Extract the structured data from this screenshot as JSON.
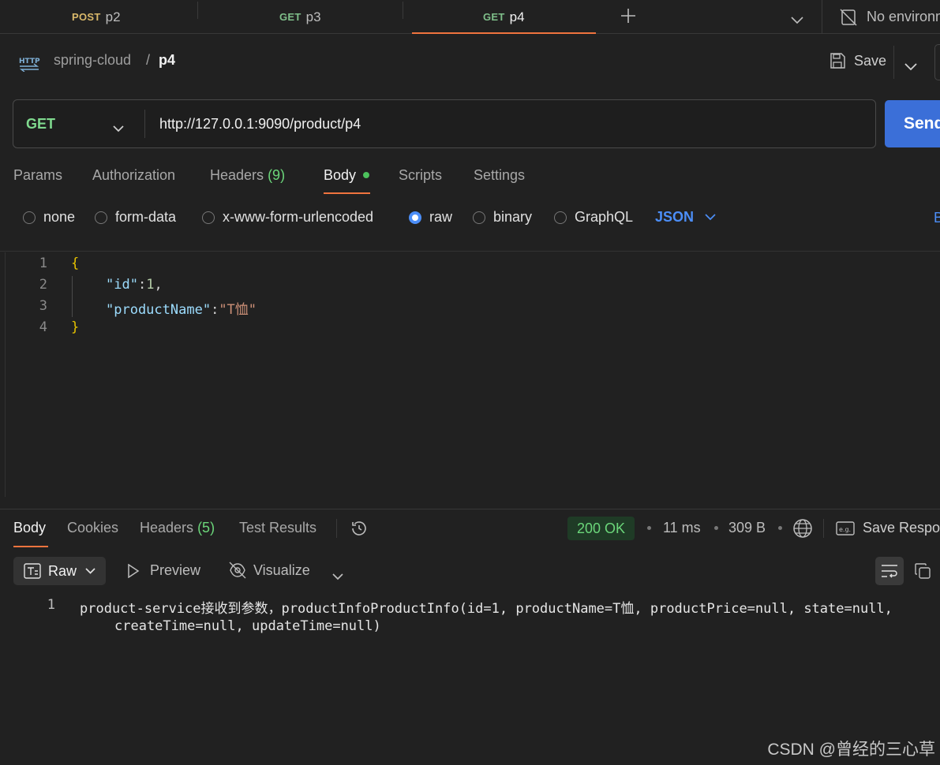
{
  "tabs": [
    {
      "method": "POST",
      "name": "p2",
      "method_color": "#d9b86a"
    },
    {
      "method": "GET",
      "name": "p3",
      "method_color": "#7fbf8a"
    },
    {
      "method": "GET",
      "name": "p4",
      "method_color": "#7fbf8a"
    }
  ],
  "environment": "No environm",
  "breadcrumb": {
    "collection": "spring-cloud",
    "separator": "/",
    "request": "p4",
    "http_badge": "HTTP"
  },
  "save_label": "Save",
  "request": {
    "method": "GET",
    "url": "http://127.0.0.1:9090/product/p4",
    "send_label": "Send"
  },
  "request_tabs": {
    "params": "Params",
    "authorization": "Authorization",
    "headers": "Headers",
    "headers_count": "(9)",
    "body": "Body",
    "scripts": "Scripts",
    "settings": "Settings"
  },
  "body_modes": {
    "none": "none",
    "form_data": "form-data",
    "urlencoded": "x-www-form-urlencoded",
    "raw": "raw",
    "binary": "binary",
    "graphql": "GraphQL",
    "format": "JSON",
    "beautify_partial": "B"
  },
  "editor": {
    "line_numbers": [
      "1",
      "2",
      "3",
      "4"
    ],
    "line1": "{",
    "line2_key": "\"id\"",
    "line2_colon": ":",
    "line2_value": "1",
    "line2_comma": ",",
    "line3_key": "\"productName\"",
    "line3_colon": ":",
    "line3_value": "\"T恤\"",
    "line4": "}"
  },
  "response": {
    "tabs": {
      "body": "Body",
      "cookies": "Cookies",
      "headers": "Headers",
      "headers_count": "(5)",
      "test_results": "Test Results"
    },
    "status": "200 OK",
    "time": "11 ms",
    "size": "309 B",
    "save_response": "Save Respo",
    "view_modes": {
      "raw": "Raw",
      "preview": "Preview",
      "visualize": "Visualize"
    },
    "line_number": "1",
    "line1": "product-service接收到参数，productInfoProductInfo(id=1, productName=T恤, productPrice=null, state=null,",
    "line2": "createTime=null, updateTime=null)"
  },
  "watermark": "CSDN @曾经的三心草",
  "colors": {
    "accent": "#f0743e",
    "send": "#3b6fd8",
    "status_ok": "#6bd67a",
    "json_key": "#9cdcfe",
    "json_number": "#b5cea8",
    "json_string": "#ce9178",
    "format_blue": "#4c8ef7"
  }
}
